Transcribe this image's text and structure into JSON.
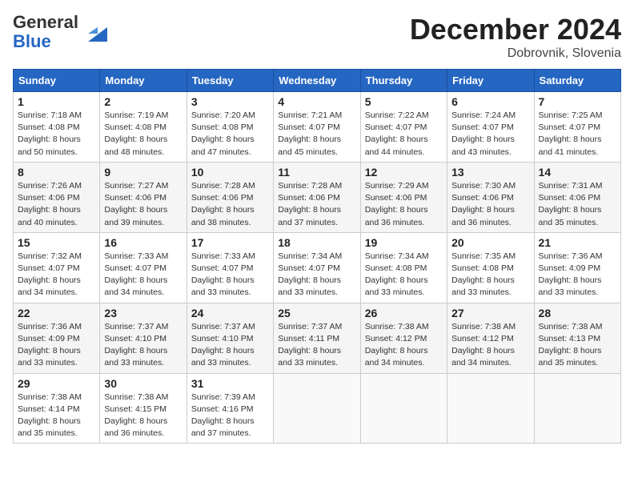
{
  "header": {
    "logo_line1": "General",
    "logo_line2": "Blue",
    "month_title": "December 2024",
    "location": "Dobrovnik, Slovenia"
  },
  "days_of_week": [
    "Sunday",
    "Monday",
    "Tuesday",
    "Wednesday",
    "Thursday",
    "Friday",
    "Saturday"
  ],
  "weeks": [
    [
      {
        "day": 1,
        "sunrise": "7:18 AM",
        "sunset": "4:08 PM",
        "daylight": "8 hours and 50 minutes."
      },
      {
        "day": 2,
        "sunrise": "7:19 AM",
        "sunset": "4:08 PM",
        "daylight": "8 hours and 48 minutes."
      },
      {
        "day": 3,
        "sunrise": "7:20 AM",
        "sunset": "4:08 PM",
        "daylight": "8 hours and 47 minutes."
      },
      {
        "day": 4,
        "sunrise": "7:21 AM",
        "sunset": "4:07 PM",
        "daylight": "8 hours and 45 minutes."
      },
      {
        "day": 5,
        "sunrise": "7:22 AM",
        "sunset": "4:07 PM",
        "daylight": "8 hours and 44 minutes."
      },
      {
        "day": 6,
        "sunrise": "7:24 AM",
        "sunset": "4:07 PM",
        "daylight": "8 hours and 43 minutes."
      },
      {
        "day": 7,
        "sunrise": "7:25 AM",
        "sunset": "4:07 PM",
        "daylight": "8 hours and 41 minutes."
      }
    ],
    [
      {
        "day": 8,
        "sunrise": "7:26 AM",
        "sunset": "4:06 PM",
        "daylight": "8 hours and 40 minutes."
      },
      {
        "day": 9,
        "sunrise": "7:27 AM",
        "sunset": "4:06 PM",
        "daylight": "8 hours and 39 minutes."
      },
      {
        "day": 10,
        "sunrise": "7:28 AM",
        "sunset": "4:06 PM",
        "daylight": "8 hours and 38 minutes."
      },
      {
        "day": 11,
        "sunrise": "7:28 AM",
        "sunset": "4:06 PM",
        "daylight": "8 hours and 37 minutes."
      },
      {
        "day": 12,
        "sunrise": "7:29 AM",
        "sunset": "4:06 PM",
        "daylight": "8 hours and 36 minutes."
      },
      {
        "day": 13,
        "sunrise": "7:30 AM",
        "sunset": "4:06 PM",
        "daylight": "8 hours and 36 minutes."
      },
      {
        "day": 14,
        "sunrise": "7:31 AM",
        "sunset": "4:06 PM",
        "daylight": "8 hours and 35 minutes."
      }
    ],
    [
      {
        "day": 15,
        "sunrise": "7:32 AM",
        "sunset": "4:07 PM",
        "daylight": "8 hours and 34 minutes."
      },
      {
        "day": 16,
        "sunrise": "7:33 AM",
        "sunset": "4:07 PM",
        "daylight": "8 hours and 34 minutes."
      },
      {
        "day": 17,
        "sunrise": "7:33 AM",
        "sunset": "4:07 PM",
        "daylight": "8 hours and 33 minutes."
      },
      {
        "day": 18,
        "sunrise": "7:34 AM",
        "sunset": "4:07 PM",
        "daylight": "8 hours and 33 minutes."
      },
      {
        "day": 19,
        "sunrise": "7:34 AM",
        "sunset": "4:08 PM",
        "daylight": "8 hours and 33 minutes."
      },
      {
        "day": 20,
        "sunrise": "7:35 AM",
        "sunset": "4:08 PM",
        "daylight": "8 hours and 33 minutes."
      },
      {
        "day": 21,
        "sunrise": "7:36 AM",
        "sunset": "4:09 PM",
        "daylight": "8 hours and 33 minutes."
      }
    ],
    [
      {
        "day": 22,
        "sunrise": "7:36 AM",
        "sunset": "4:09 PM",
        "daylight": "8 hours and 33 minutes."
      },
      {
        "day": 23,
        "sunrise": "7:37 AM",
        "sunset": "4:10 PM",
        "daylight": "8 hours and 33 minutes."
      },
      {
        "day": 24,
        "sunrise": "7:37 AM",
        "sunset": "4:10 PM",
        "daylight": "8 hours and 33 minutes."
      },
      {
        "day": 25,
        "sunrise": "7:37 AM",
        "sunset": "4:11 PM",
        "daylight": "8 hours and 33 minutes."
      },
      {
        "day": 26,
        "sunrise": "7:38 AM",
        "sunset": "4:12 PM",
        "daylight": "8 hours and 34 minutes."
      },
      {
        "day": 27,
        "sunrise": "7:38 AM",
        "sunset": "4:12 PM",
        "daylight": "8 hours and 34 minutes."
      },
      {
        "day": 28,
        "sunrise": "7:38 AM",
        "sunset": "4:13 PM",
        "daylight": "8 hours and 35 minutes."
      }
    ],
    [
      {
        "day": 29,
        "sunrise": "7:38 AM",
        "sunset": "4:14 PM",
        "daylight": "8 hours and 35 minutes."
      },
      {
        "day": 30,
        "sunrise": "7:38 AM",
        "sunset": "4:15 PM",
        "daylight": "8 hours and 36 minutes."
      },
      {
        "day": 31,
        "sunrise": "7:39 AM",
        "sunset": "4:16 PM",
        "daylight": "8 hours and 37 minutes."
      },
      null,
      null,
      null,
      null
    ]
  ]
}
